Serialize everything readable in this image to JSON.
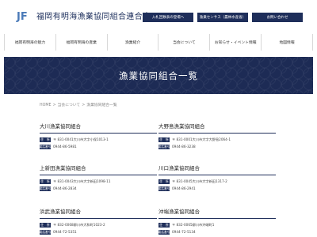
{
  "header": {
    "logo_text": "JF",
    "site_title": "福岡有明海漁業協同組合連合会",
    "buttons": [
      "入札回数表の登場へ",
      "漁業センサス（農林水産省）",
      "お問い合わせ"
    ]
  },
  "nav": [
    "福岡有明海の魅力",
    "福岡有明海の産業",
    "漁業紹介",
    "当会について",
    "お知らせ・イベント情報",
    "地図情報"
  ],
  "hero": {
    "title": "漁業協同組合一覧"
  },
  "breadcrumb": [
    "HOME",
    "当会について",
    "漁業協同組合一覧"
  ],
  "labels": {
    "address": "住　所",
    "phone": "電話番号"
  },
  "cooperatives": [
    {
      "name": "大川漁業協同組合",
      "address": "〒 831-0041大川市大字小保1013-1",
      "phone": "0944-86-5981"
    },
    {
      "name": "大野島漁業協同組合",
      "address": "〒 831-0001大川市大字大野島2064-1",
      "phone": "0944-86-3238"
    },
    {
      "name": "上新田漁業協同組合",
      "address": "〒 831-0043大川市大字新田1098-11",
      "phone": "0944-86-2834"
    },
    {
      "name": "川口漁業協同組合",
      "address": "〒 831-0045大川市大字新田1317-2",
      "phone": "0944-86-2941"
    },
    {
      "name": "浜武漁業協同組合",
      "address": "〒 832-0068柳川市大和町1023-2",
      "phone": "0944-72-5351"
    },
    {
      "name": "沖端漁業協同組合",
      "address": "〒 832-0065柳川市沖端町1",
      "phone": "0944-72-5134"
    }
  ]
}
